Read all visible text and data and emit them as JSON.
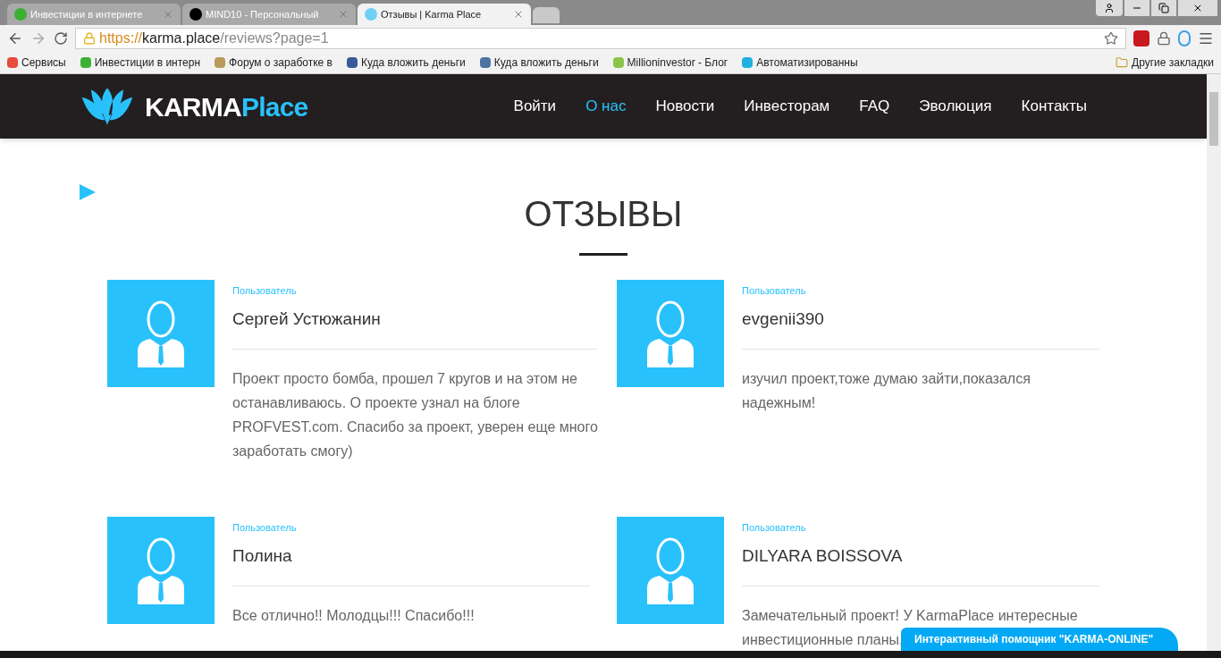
{
  "browser": {
    "tabs": [
      {
        "title": "Инвестиции в интернете",
        "selected": false
      },
      {
        "title": "MIND10 - Персональный",
        "selected": false
      },
      {
        "title": "Отзывы | Karma Place",
        "selected": true
      }
    ],
    "url": {
      "scheme": "https://",
      "host": "karma.place",
      "path": "/reviews?page=1"
    },
    "bookmarks": [
      "Сервисы",
      "Инвестиции в интерн",
      "Форум о заработке в",
      "Куда вложить деньги",
      "Куда вложить деньги",
      "Millioninvestor - Блог",
      "Автоматизированны"
    ],
    "other_bookmarks": "Другие закладки"
  },
  "site": {
    "logo": {
      "first": "KARMA",
      "second": "Place"
    },
    "nav": [
      {
        "label": "Войти",
        "selected": false
      },
      {
        "label": "О нас",
        "selected": true
      },
      {
        "label": "Новости",
        "selected": false
      },
      {
        "label": "Инвесторам",
        "selected": false
      },
      {
        "label": "FAQ",
        "selected": false
      },
      {
        "label": "Эволюция",
        "selected": false
      },
      {
        "label": "Контакты",
        "selected": false
      }
    ],
    "heading": "ОТЗЫВЫ",
    "reviews": [
      {
        "role": "Пользователь",
        "name": "Сергей Устюжанин",
        "text_lines": [
          "Проект просто бомба, прошел 7 кругов и на этом не",
          "останавливаюсь. О проекте узнал на блоге",
          "PROFVEST.com. Спасибо за проект, уверен еще много",
          "заработать смогу)"
        ]
      },
      {
        "role": "Пользователь",
        "name": "evgenii390",
        "text_lines": [
          "изучил проект,тоже думаю зайти,показался",
          "надежным!"
        ]
      },
      {
        "role": "Пользователь",
        "name": "Полина",
        "text_lines": [
          "Все отлично!! Молодцы!!! Спасибо!!!"
        ]
      },
      {
        "role": "Пользователь",
        "name": "DILYARA BOISSOVA",
        "text_lines": [
          "Замечательный проект! У KarmaPlace интересные",
          "инвестиционные планы,"
        ]
      }
    ],
    "chat": "Интерактивный помощник \"KARMA-ONLINE\""
  }
}
